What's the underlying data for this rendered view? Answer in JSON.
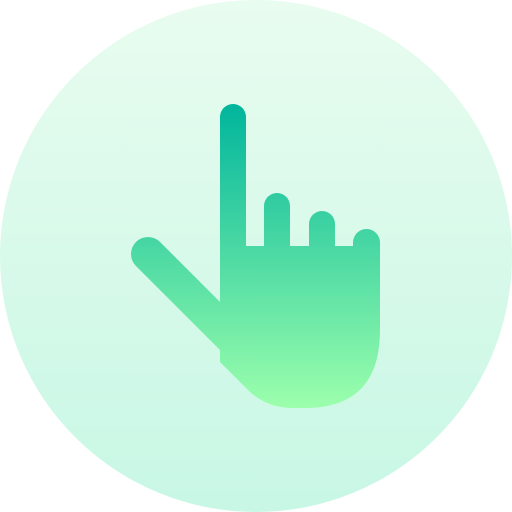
{
  "icon": {
    "name": "pointing-hand-icon",
    "colors": {
      "background_top": "#e8fcef",
      "background_bottom": "#c8f7e5",
      "hand_top": "#00b59c",
      "hand_bottom": "#9cffac"
    }
  }
}
